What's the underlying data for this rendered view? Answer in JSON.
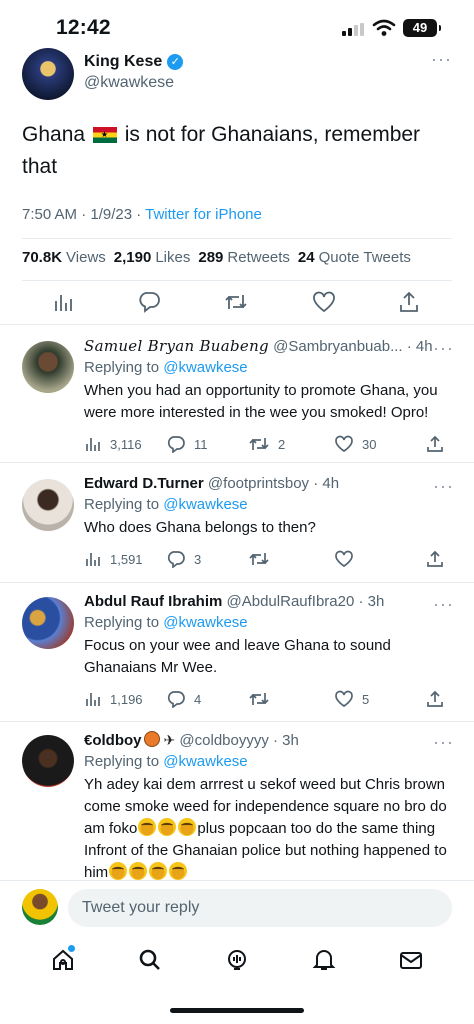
{
  "status_bar": {
    "time": "12:42",
    "battery": "49"
  },
  "main_tweet": {
    "author_name": "King Kese",
    "author_handle": "@kwawkese",
    "text_before_flag": "Ghana",
    "text_after_flag": "is not for Ghanaians, remember that",
    "time": "7:50 AM · 1/9/23 · ",
    "source": "Twitter for iPhone",
    "stats": {
      "views_value": "70.8K",
      "views_label": "Views",
      "likes_value": "2,190",
      "likes_label": "Likes",
      "retweets_value": "289",
      "retweets_label": "Retweets",
      "quotes_value": "24",
      "quotes_label": "Quote Tweets"
    },
    "more": "···"
  },
  "replies": [
    {
      "name": "Samuel Bryan Buabeng",
      "handle": "@Sambryanbuab... · 4h",
      "replying_to_label": "Replying to",
      "replying_to_handle": "@kwawkese",
      "text": "When you had an opportunity to promote Ghana, you were more interested in the wee you smoked!  Opro!",
      "views": "3,116",
      "replies": "11",
      "retweets": "2",
      "likes": "30"
    },
    {
      "name": "Edward D.Turner",
      "handle": "@footprintsboy · 4h",
      "replying_to_label": "Replying to",
      "replying_to_handle": "@kwawkese",
      "text": "Who does Ghana belongs to then?",
      "views": "1,591",
      "replies": "3",
      "retweets": "",
      "likes": ""
    },
    {
      "name": "Abdul Rauf Ibrahim",
      "handle": "@AbdulRaufIbra20 · 3h",
      "replying_to_label": "Replying to",
      "replying_to_handle": "@kwawkese",
      "text": "Focus on your wee and leave Ghana to sound Ghanaians Mr Wee.",
      "views": "1,196",
      "replies": "4",
      "retweets": "",
      "likes": "5"
    },
    {
      "name": "€oldboy",
      "handle": "@coldboyyyy · 3h",
      "replying_to_label": "Replying to",
      "replying_to_handle": "@kwawkese",
      "text_part1": "Yh adey kai dem arrrest u sekof weed but Chris brown come smoke weed for independence square no bro do am foko",
      "text_part2": "plus popcaan too do the same thing Infront of the Ghanaian police but nothing happened to him"
    }
  ],
  "compose": {
    "placeholder": "Tweet your reply"
  },
  "tabs": [
    "home-icon",
    "search-icon",
    "spaces-icon",
    "notifications-icon",
    "messages-icon"
  ]
}
